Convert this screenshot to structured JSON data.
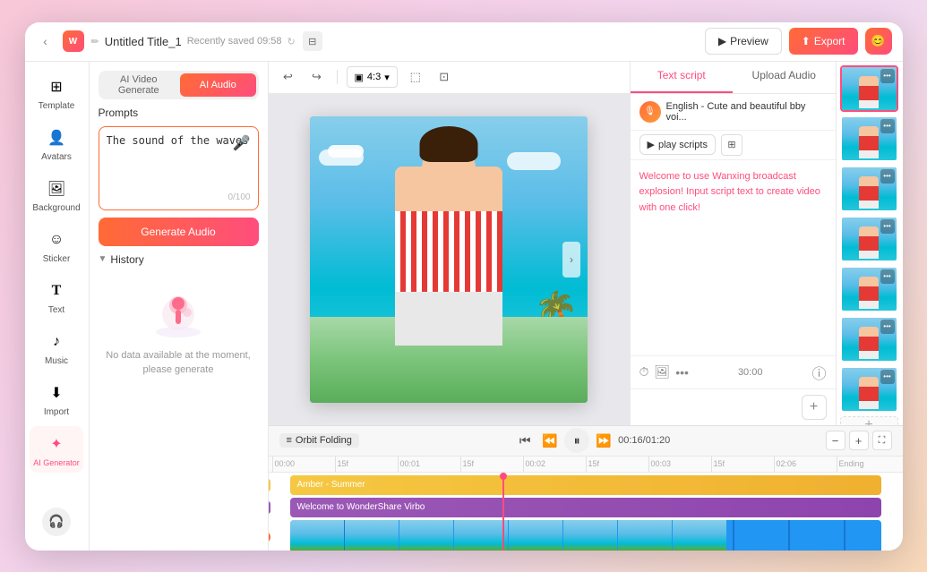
{
  "app": {
    "title": "Untitled Title_1",
    "saved_text": "Recently saved 09:58",
    "logo_letter": "W"
  },
  "toolbar": {
    "ratio_label": "4:3",
    "preview_label": "Preview",
    "export_label": "Export"
  },
  "sidebar": {
    "items": [
      {
        "id": "template",
        "label": "Template",
        "icon": "⊞"
      },
      {
        "id": "avatars",
        "label": "Avatars",
        "icon": "👤"
      },
      {
        "id": "background",
        "label": "Background",
        "icon": "🖼"
      },
      {
        "id": "sticker",
        "label": "Sticker",
        "icon": "☺"
      },
      {
        "id": "text",
        "label": "Text",
        "icon": "T"
      },
      {
        "id": "music",
        "label": "Music",
        "icon": "♪"
      },
      {
        "id": "import",
        "label": "Import",
        "icon": "⬇"
      },
      {
        "id": "ai-generator",
        "label": "AI Generator",
        "icon": "✦"
      }
    ]
  },
  "panel": {
    "tab_video": "AI Video Generate",
    "tab_audio": "AI Audio",
    "prompts_label": "Prompts",
    "prompt_value": "The sound of the waves",
    "char_count": "0/100",
    "generate_btn": "Generate Audio",
    "history_label": "History",
    "empty_text": "No data available at the moment, please generate"
  },
  "right_panel": {
    "tab_script": "Text script",
    "tab_audio": "Upload Audio",
    "voice_name": "English - Cute and beautiful bby voi...",
    "play_scripts_label": "play scripts",
    "welcome_text": "Welcome to use Wanxing broadcast explosion! Input script text to create video with one click!",
    "time_display": "30:00",
    "add_btn": "+"
  },
  "timeline": {
    "label": "Orbit Folding",
    "current_time": "00:16",
    "total_time": "01:20",
    "track_amber": "Amber - Summer",
    "track_purple": "Welcome to WonderShare Virbo",
    "rulers": [
      "00:00",
      "15f",
      "00:01",
      "15f",
      "00:02",
      "15f",
      "00:03",
      "15f",
      "02:06",
      "Ending"
    ]
  }
}
